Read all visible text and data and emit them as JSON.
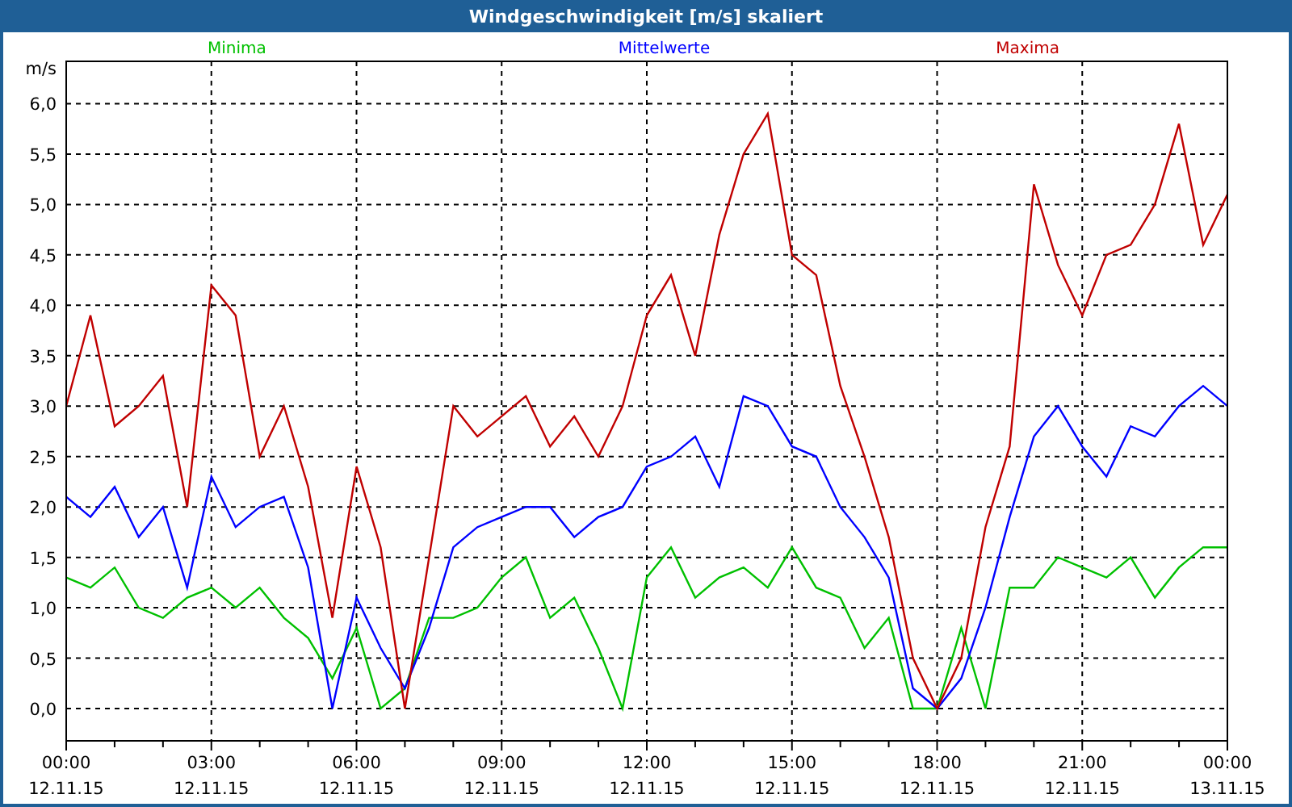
{
  "window": {
    "title": "Windgeschwindigkeit [m/s] skaliert"
  },
  "chart": {
    "chart_data": {
      "type": "line",
      "ylabel": "m/s",
      "categories": [
        "00:00\n12.11.15",
        null,
        null,
        null,
        null,
        null,
        "03:00\n12.11.15",
        null,
        null,
        null,
        null,
        null,
        "06:00\n12.11.15",
        null,
        null,
        null,
        null,
        null,
        "09:00\n12.11.15",
        null,
        null,
        null,
        null,
        null,
        "12:00\n12.11.15",
        null,
        null,
        null,
        null,
        null,
        "15:00\n12.11.15",
        null,
        null,
        null,
        null,
        null,
        "18:00\n12.11.15",
        null,
        null,
        null,
        null,
        null,
        "21:00\n12.11.15",
        null,
        null,
        null,
        null,
        null,
        "00:00\n13.11.15"
      ],
      "series": [
        {
          "name": "Minima",
          "color": "#00c000",
          "values": [
            1.3,
            1.2,
            1.4,
            1.0,
            0.9,
            1.1,
            1.2,
            1.0,
            1.2,
            0.9,
            0.7,
            0.3,
            0.8,
            0.0,
            0.2,
            0.9,
            0.9,
            1.0,
            1.3,
            1.5,
            0.9,
            1.1,
            0.6,
            0.0,
            1.3,
            1.6,
            1.1,
            1.3,
            1.4,
            1.2,
            1.6,
            1.2,
            1.1,
            0.6,
            0.9,
            0.0,
            0.0,
            0.8,
            0.0,
            1.2,
            1.2,
            1.5,
            1.4,
            1.3,
            1.5,
            1.1,
            1.4,
            1.6,
            1.6
          ]
        },
        {
          "name": "Mittelwerte",
          "color": "#0000ff",
          "values": [
            2.1,
            1.9,
            2.2,
            1.7,
            2.0,
            1.2,
            2.3,
            1.8,
            2.0,
            2.1,
            1.4,
            0.0,
            1.1,
            0.6,
            0.2,
            0.8,
            1.6,
            1.8,
            1.9,
            2.0,
            2.0,
            1.7,
            1.9,
            2.0,
            2.4,
            2.5,
            2.7,
            2.2,
            3.1,
            3.0,
            2.6,
            2.5,
            2.0,
            1.7,
            1.3,
            0.2,
            0.0,
            0.3,
            1.0,
            1.9,
            2.7,
            3.0,
            2.6,
            2.3,
            2.8,
            2.7,
            3.0,
            3.2,
            3.0
          ]
        },
        {
          "name": "Maxima",
          "color": "#c00000",
          "values": [
            3.0,
            3.9,
            2.8,
            3.0,
            3.3,
            2.0,
            4.2,
            3.9,
            2.5,
            3.0,
            2.2,
            0.9,
            2.4,
            1.6,
            0.0,
            1.5,
            3.0,
            2.7,
            2.9,
            3.1,
            2.6,
            2.9,
            2.5,
            3.0,
            3.9,
            4.3,
            3.5,
            4.7,
            5.5,
            5.9,
            4.5,
            4.3,
            3.2,
            2.5,
            1.7,
            0.5,
            0.0,
            0.5,
            1.8,
            2.6,
            5.2,
            4.4,
            3.9,
            4.5,
            4.6,
            5.0,
            5.8,
            4.6,
            5.1
          ]
        }
      ],
      "ylim": [
        -0.32,
        6.42
      ],
      "grid": true,
      "yticks": [
        {
          "value": 0,
          "label": "0,0"
        },
        {
          "value": 0.5,
          "label": "0,5"
        },
        {
          "value": 1,
          "label": "1,0"
        },
        {
          "value": 1.5,
          "label": "1,5"
        },
        {
          "value": 2,
          "label": "2,0"
        },
        {
          "value": 2.5,
          "label": "2,5"
        },
        {
          "value": 3,
          "label": "3,0"
        },
        {
          "value": 3.5,
          "label": "3,5"
        },
        {
          "value": 4,
          "label": "4,0"
        },
        {
          "value": 4.5,
          "label": "4,5"
        },
        {
          "value": 5,
          "label": "5,0"
        },
        {
          "value": 5.5,
          "label": "5,5"
        },
        {
          "value": 6,
          "label": "6,0"
        }
      ]
    }
  }
}
